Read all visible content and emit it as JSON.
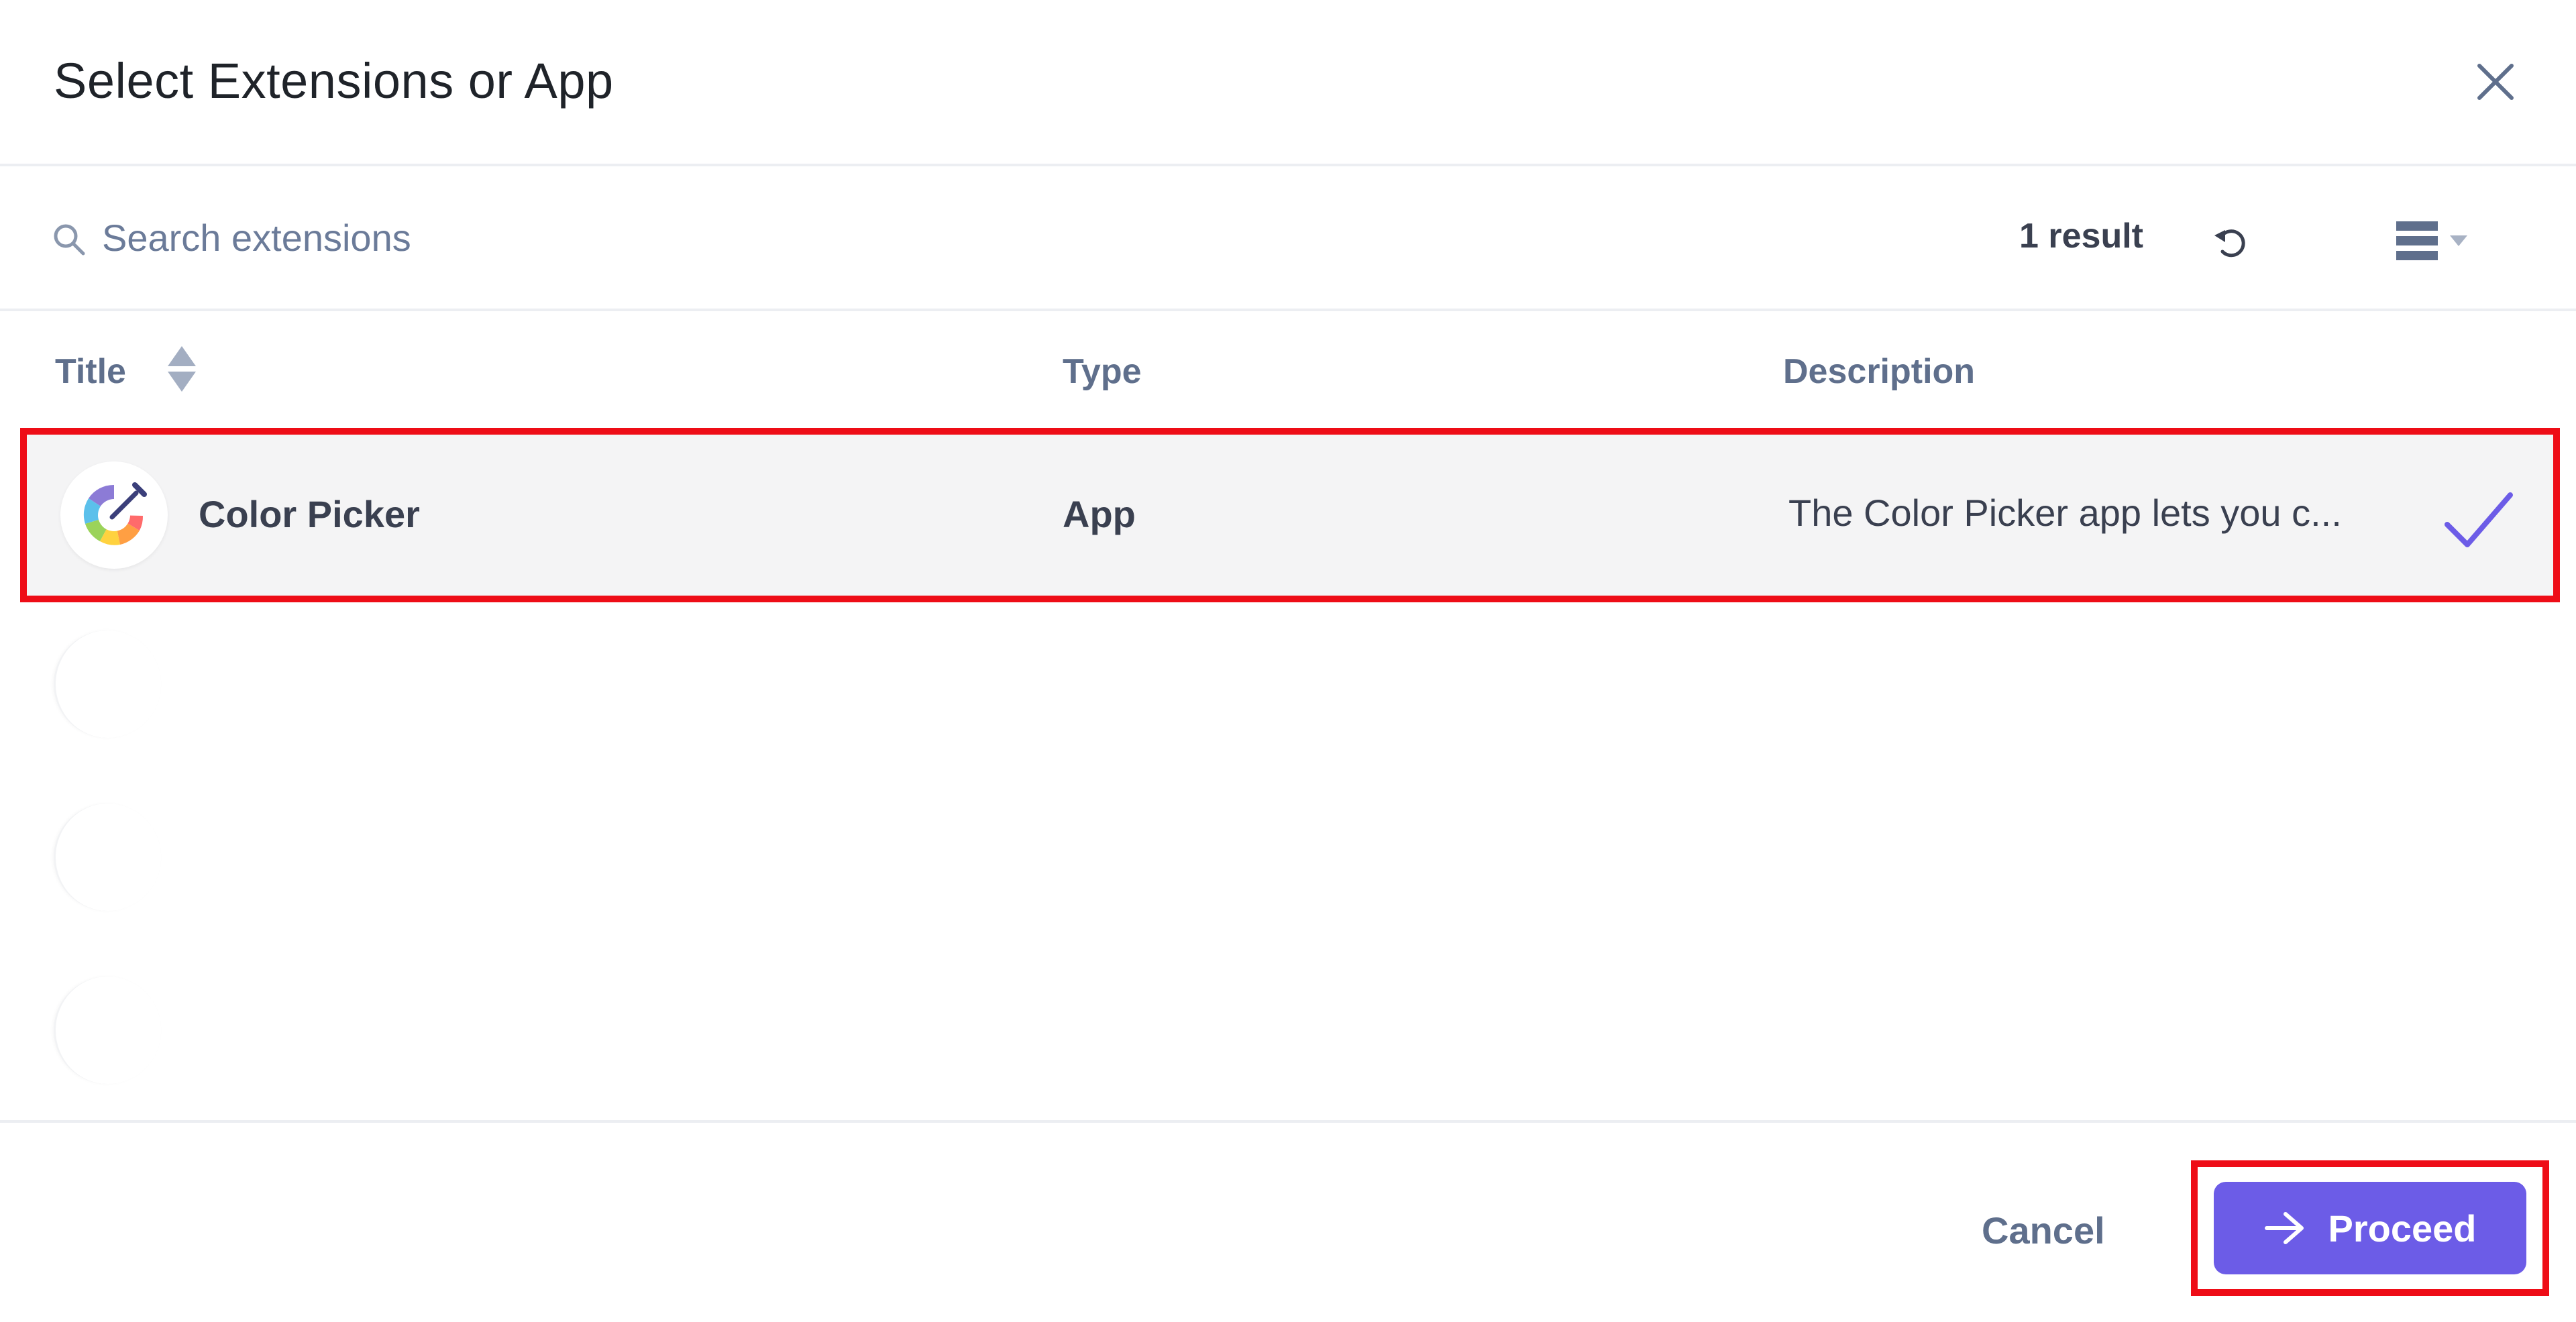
{
  "dialog": {
    "title": "Select Extensions or App"
  },
  "search": {
    "placeholder": "Search extensions",
    "value": "",
    "result_count": "1 result"
  },
  "table": {
    "columns": [
      "Title",
      "Type",
      "Description"
    ],
    "rows": [
      {
        "title": "Color Picker",
        "type": "App",
        "description": "The Color Picker app lets you c...",
        "selected": true
      }
    ]
  },
  "footer": {
    "cancel_label": "Cancel",
    "proceed_label": "Proceed"
  },
  "colors": {
    "accent": "#6c5ce7",
    "highlight_border": "#ee0d17",
    "selected_row_bg": "#f4f4f5",
    "muted_text": "#5f6f8c"
  },
  "icons": {
    "close": "close-icon",
    "search": "search-icon",
    "refresh": "refresh-icon",
    "view": "list-view-icon",
    "sort": "sort-icon",
    "app": "color-picker-app-icon",
    "check": "checkmark-icon",
    "proceed": "arrow-right-icon"
  }
}
